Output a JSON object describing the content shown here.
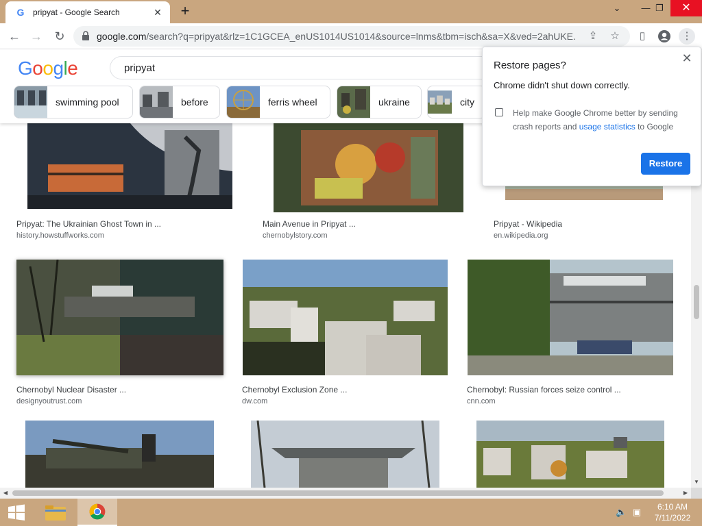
{
  "browser": {
    "tab_title": "pripyat - Google Search",
    "url_host": "google.com",
    "url_rest": "/search?q=pripyat&rlz=1C1GCEA_enUS1014US1014&source=lnms&tbm=isch&sa=X&ved=2ahUKE..."
  },
  "google": {
    "logo_letters": [
      "G",
      "o",
      "o",
      "g",
      "l",
      "e"
    ],
    "logo_colors": [
      "#4285f4",
      "#ea4335",
      "#fbbc05",
      "#4285f4",
      "#34a853",
      "#ea4335"
    ],
    "query": "pripyat"
  },
  "chips": [
    {
      "label": "swimming pool"
    },
    {
      "label": "before"
    },
    {
      "label": "ferris wheel"
    },
    {
      "label": "ukraine"
    },
    {
      "label": "city"
    }
  ],
  "results": [
    {
      "title": "Pripyat: The Ukrainian Ghost Town in ...",
      "source": "history.howstuffworks.com"
    },
    {
      "title": "Main Avenue in Pripyat ...",
      "source": "chernobylstory.com"
    },
    {
      "title": "Pripyat - Wikipedia",
      "source": "en.wikipedia.org"
    },
    {
      "title": "Chernobyl Nuclear Disaster ...",
      "source": "designyoutrust.com"
    },
    {
      "title": "Chernobyl Exclusion Zone ...",
      "source": "dw.com"
    },
    {
      "title": "Chernobyl: Russian forces seize control ...",
      "source": "cnn.com"
    },
    {
      "title": "",
      "source": ""
    },
    {
      "title": "",
      "source": ""
    },
    {
      "title": "",
      "source": ""
    }
  ],
  "dialog": {
    "title": "Restore pages?",
    "message": "Chrome didn't shut down correctly.",
    "checkbox_text": "Help make Google Chrome better by sending crash reports and ",
    "checkbox_link": "usage statistics",
    "checkbox_tail": " to Google",
    "restore_label": "Restore"
  },
  "taskbar": {
    "time": "6:10 AM",
    "date": "7/11/2022"
  }
}
